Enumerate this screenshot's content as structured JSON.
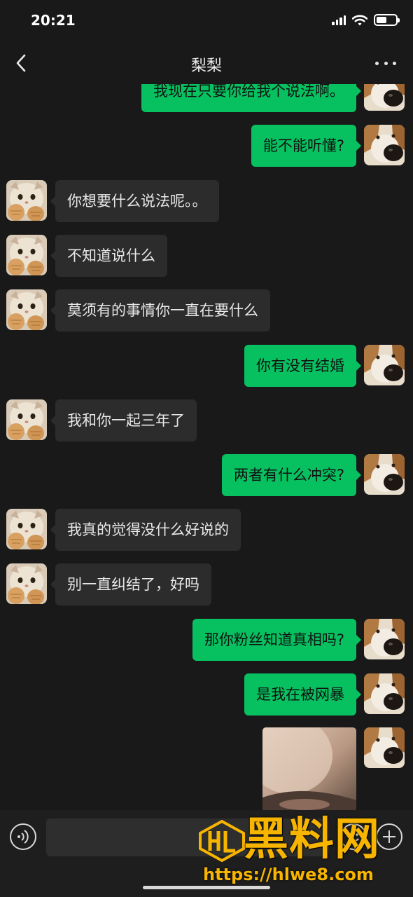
{
  "status_bar": {
    "time": "20:21",
    "battery_level": 0.55,
    "icons": [
      "signal-icon",
      "wifi-icon",
      "battery-icon"
    ]
  },
  "nav": {
    "title": "梨梨",
    "back_icon": "chevron-left-icon",
    "more_icon": "more-dots-icon"
  },
  "messages": [
    {
      "side": "out",
      "text": "我现在只要你给我个说法啊。"
    },
    {
      "side": "out",
      "text": "能不能听懂?"
    },
    {
      "side": "in",
      "text": "你想要什么说法呢。。"
    },
    {
      "side": "in",
      "text": "不知道说什么"
    },
    {
      "side": "in",
      "text": "莫须有的事情你一直在要什么"
    },
    {
      "side": "out",
      "text": "你有没有结婚"
    },
    {
      "side": "in",
      "text": "我和你一起三年了"
    },
    {
      "side": "out",
      "text": "两者有什么冲突?"
    },
    {
      "side": "in",
      "text": "我真的觉得没什么好说的"
    },
    {
      "side": "in",
      "text": "别一直纠结了，好吗"
    },
    {
      "side": "out",
      "text": "那你粉丝知道真相吗?"
    },
    {
      "side": "out",
      "text": "是我在被网暴"
    },
    {
      "side": "out",
      "type": "image",
      "text": ""
    }
  ],
  "input_bar": {
    "value": "",
    "icons": [
      "voice-icon",
      "emoji-icon",
      "plus-icon"
    ]
  },
  "watermark": {
    "name": "黑料网",
    "url": "https://hlwe8.com",
    "logo_text": "HL"
  },
  "colors": {
    "background": "#191919",
    "outgoing_bubble": "#07c160",
    "incoming_bubble": "#2c2c2c",
    "watermark": "#f7b500"
  }
}
